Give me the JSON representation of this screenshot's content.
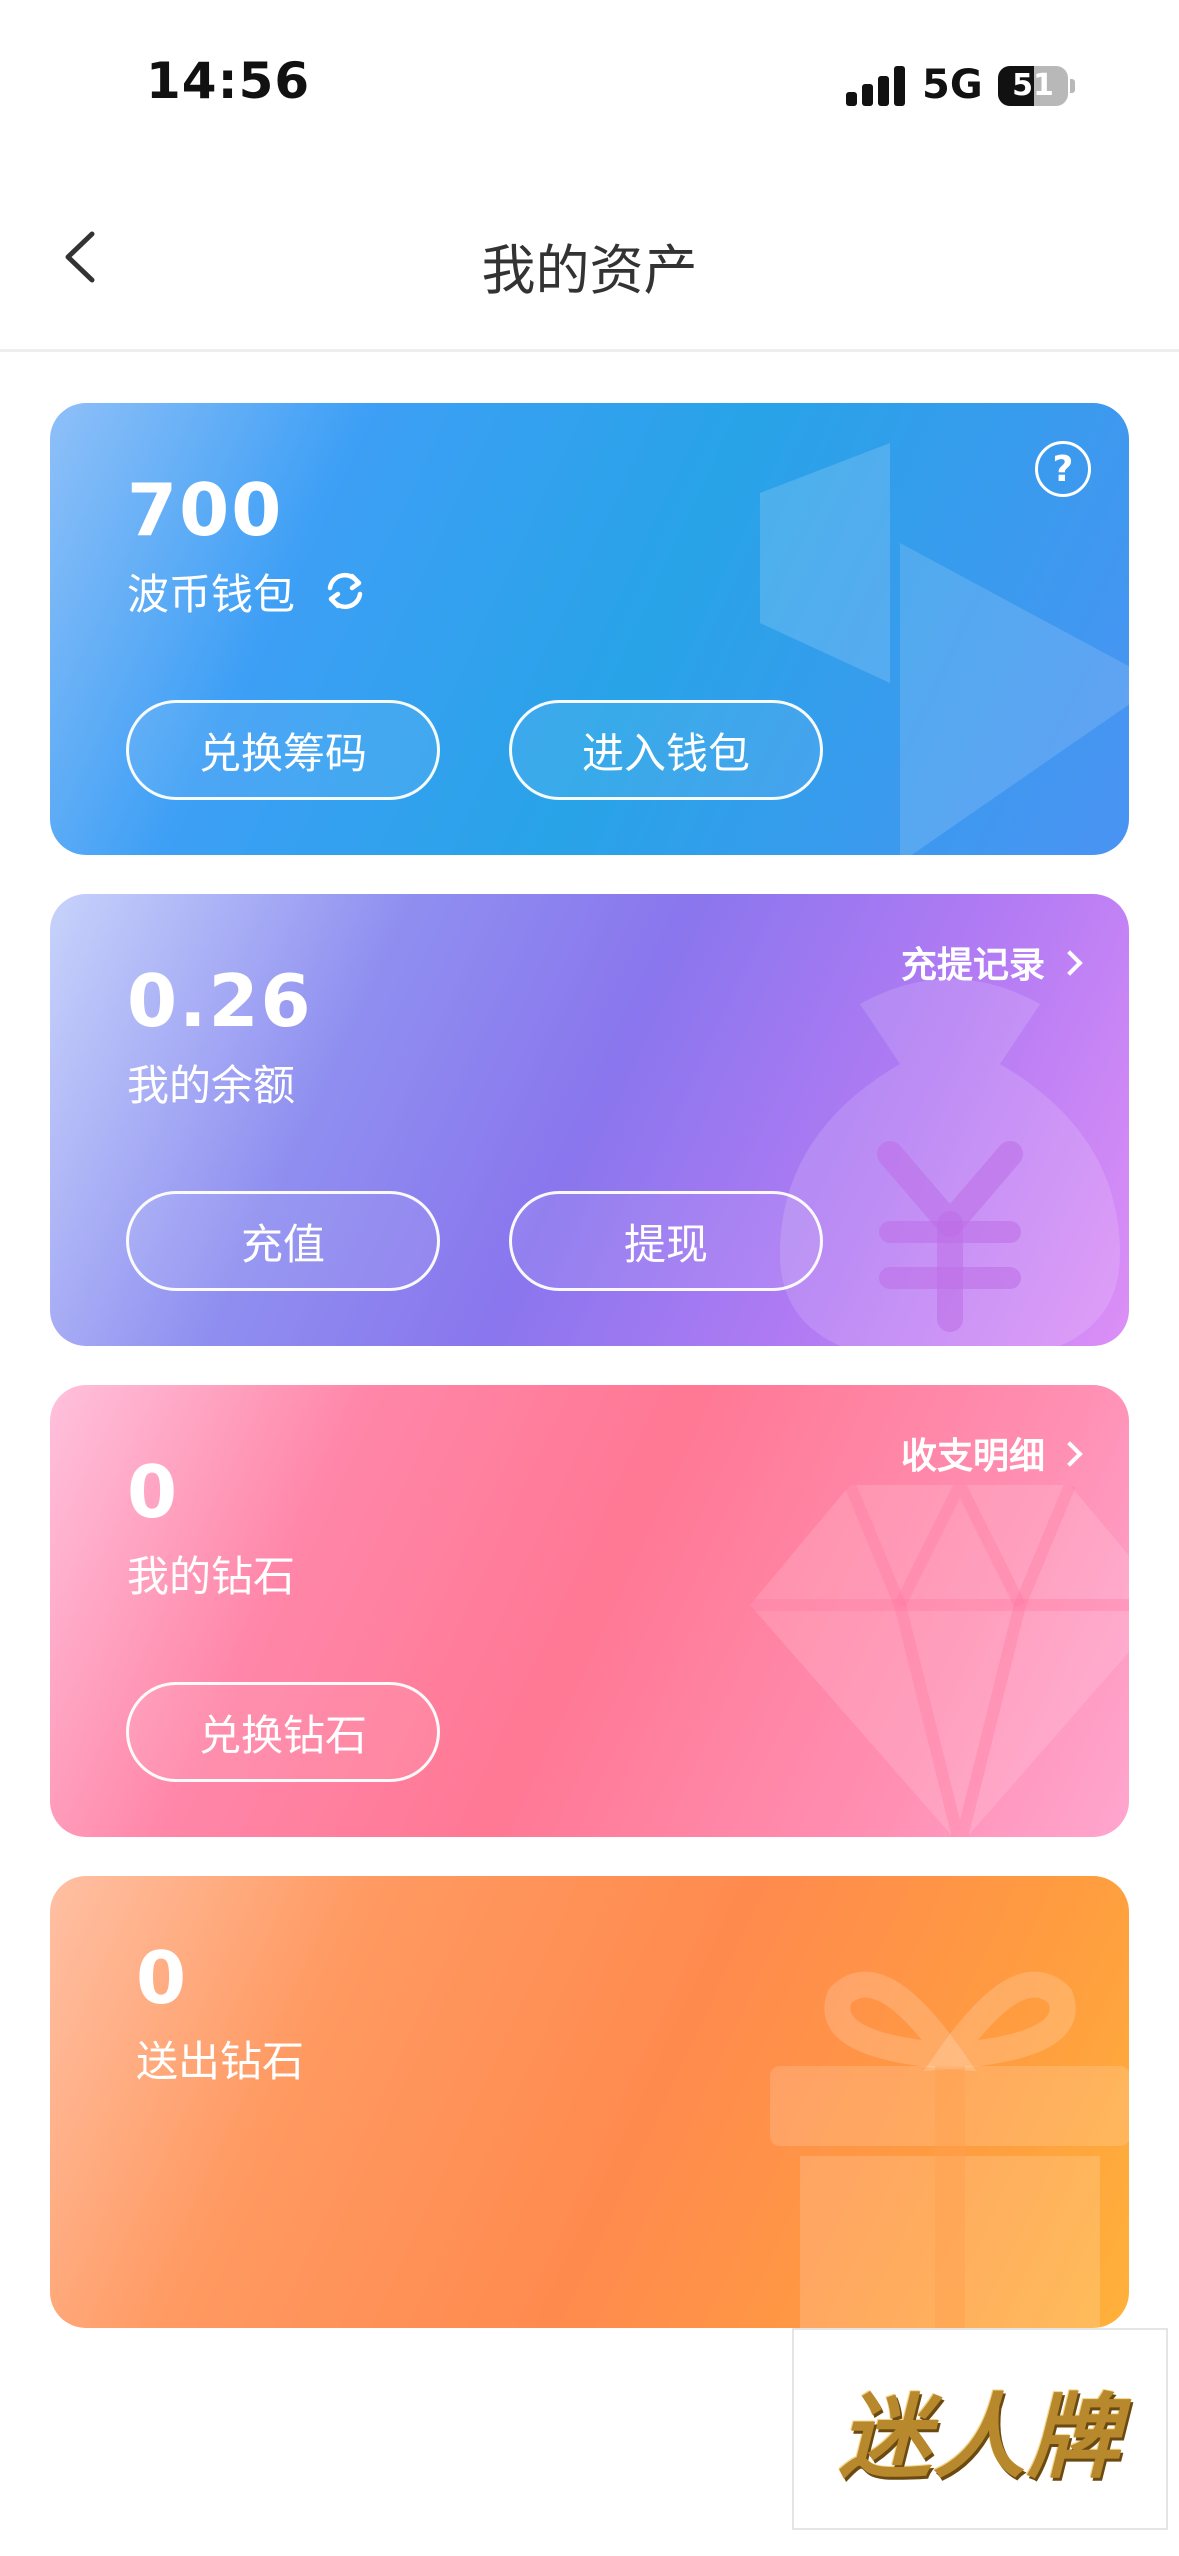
{
  "status_bar": {
    "time": "14:56",
    "network": "5G",
    "battery_level": "51",
    "battery_percent": 51
  },
  "nav": {
    "title": "我的资产",
    "back_icon": "chevron-left-icon"
  },
  "cards": {
    "wallet": {
      "value": "700",
      "label": "波币钱包",
      "refresh_icon": "refresh-icon",
      "help_icon": "help-icon",
      "help_text": "?",
      "button_left": "兑换筹码",
      "button_right": "进入钱包",
      "deco_icon": "play-icon"
    },
    "balance": {
      "value": "0.26",
      "label": "我的余额",
      "link": "充提记录",
      "button_left": "充值",
      "button_right": "提现",
      "deco_icon": "money-bag-yen-icon"
    },
    "diamond": {
      "value": "0",
      "label": "我的钻石",
      "link": "收支明细",
      "button_left": "兑换钻石",
      "deco_icon": "diamond-icon"
    },
    "sent": {
      "value": "0",
      "label": "送出钻石",
      "deco_icon": "gift-icon"
    }
  },
  "watermark": {
    "text": "迷人牌"
  },
  "colors": {
    "wallet_card": "#3d9ff5",
    "balance_card": "#8a76ee",
    "diamond_card": "#ff7894",
    "sent_card": "#ff8a4e",
    "title_text": "#333333"
  }
}
